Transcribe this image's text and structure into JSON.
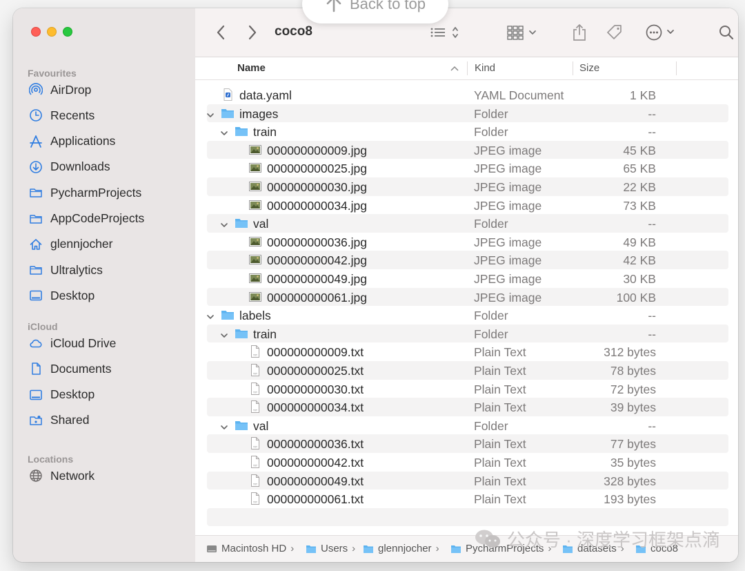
{
  "window": {
    "title": "coco8"
  },
  "back_to_top": "Back to top",
  "sidebar": {
    "sections": [
      {
        "title": "Favourites",
        "items": [
          {
            "label": "AirDrop",
            "icon": "airdrop-icon"
          },
          {
            "label": "Recents",
            "icon": "clock-icon"
          },
          {
            "label": "Applications",
            "icon": "applications-icon"
          },
          {
            "label": "Downloads",
            "icon": "download-icon"
          },
          {
            "label": "PycharmProjects",
            "icon": "folder-icon"
          },
          {
            "label": "AppCodeProjects",
            "icon": "folder-icon"
          },
          {
            "label": "glennjocher",
            "icon": "home-icon"
          },
          {
            "label": "Ultralytics",
            "icon": "folder-icon"
          },
          {
            "label": "Desktop",
            "icon": "desktop-icon"
          }
        ]
      },
      {
        "title": "iCloud",
        "items": [
          {
            "label": "iCloud Drive",
            "icon": "cloud-icon"
          },
          {
            "label": "Documents",
            "icon": "document-icon"
          },
          {
            "label": "Desktop",
            "icon": "desktop-icon"
          },
          {
            "label": "Shared",
            "icon": "shared-folder-icon"
          }
        ]
      },
      {
        "title": "Locations",
        "items": [
          {
            "label": "Network",
            "icon": "globe-icon"
          }
        ]
      }
    ]
  },
  "columns": {
    "name": "Name",
    "kind": "Kind",
    "size": "Size"
  },
  "files": [
    {
      "name": "data.yaml",
      "kind": "YAML Document",
      "size": "1 KB",
      "type": "yaml",
      "level": 0
    },
    {
      "name": "images",
      "kind": "Folder",
      "size": "--",
      "type": "folder",
      "level": 0,
      "expanded": true
    },
    {
      "name": "train",
      "kind": "Folder",
      "size": "--",
      "type": "folder",
      "level": 1,
      "expanded": true
    },
    {
      "name": "000000000009.jpg",
      "kind": "JPEG image",
      "size": "45 KB",
      "type": "jpg",
      "level": 2
    },
    {
      "name": "000000000025.jpg",
      "kind": "JPEG image",
      "size": "65 KB",
      "type": "jpg",
      "level": 2
    },
    {
      "name": "000000000030.jpg",
      "kind": "JPEG image",
      "size": "22 KB",
      "type": "jpg",
      "level": 2
    },
    {
      "name": "000000000034.jpg",
      "kind": "JPEG image",
      "size": "73 KB",
      "type": "jpg",
      "level": 2
    },
    {
      "name": "val",
      "kind": "Folder",
      "size": "--",
      "type": "folder",
      "level": 1,
      "expanded": true
    },
    {
      "name": "000000000036.jpg",
      "kind": "JPEG image",
      "size": "49 KB",
      "type": "jpg",
      "level": 2
    },
    {
      "name": "000000000042.jpg",
      "kind": "JPEG image",
      "size": "42 KB",
      "type": "jpg",
      "level": 2
    },
    {
      "name": "000000000049.jpg",
      "kind": "JPEG image",
      "size": "30 KB",
      "type": "jpg",
      "level": 2
    },
    {
      "name": "000000000061.jpg",
      "kind": "JPEG image",
      "size": "100 KB",
      "type": "jpg",
      "level": 2
    },
    {
      "name": "labels",
      "kind": "Folder",
      "size": "--",
      "type": "folder",
      "level": 0,
      "expanded": true
    },
    {
      "name": "train",
      "kind": "Folder",
      "size": "--",
      "type": "folder",
      "level": 1,
      "expanded": true
    },
    {
      "name": "000000000009.txt",
      "kind": "Plain Text",
      "size": "312 bytes",
      "type": "txt",
      "level": 2
    },
    {
      "name": "000000000025.txt",
      "kind": "Plain Text",
      "size": "78 bytes",
      "type": "txt",
      "level": 2
    },
    {
      "name": "000000000030.txt",
      "kind": "Plain Text",
      "size": "72 bytes",
      "type": "txt",
      "level": 2
    },
    {
      "name": "000000000034.txt",
      "kind": "Plain Text",
      "size": "39 bytes",
      "type": "txt",
      "level": 2
    },
    {
      "name": "val",
      "kind": "Folder",
      "size": "--",
      "type": "folder",
      "level": 1,
      "expanded": true
    },
    {
      "name": "000000000036.txt",
      "kind": "Plain Text",
      "size": "77 bytes",
      "type": "txt",
      "level": 2
    },
    {
      "name": "000000000042.txt",
      "kind": "Plain Text",
      "size": "35 bytes",
      "type": "txt",
      "level": 2
    },
    {
      "name": "000000000049.txt",
      "kind": "Plain Text",
      "size": "328 bytes",
      "type": "txt",
      "level": 2
    },
    {
      "name": "000000000061.txt",
      "kind": "Plain Text",
      "size": "193 bytes",
      "type": "txt",
      "level": 2
    }
  ],
  "pathbar": [
    "Macintosh HD",
    "Users",
    "glennjocher",
    "PycharmProjects",
    "datasets",
    "coco8"
  ],
  "watermark": "公众号 · 深度学习框架点滴",
  "colors": {
    "folder": "#5cb3f0",
    "accent": "#2f7de1"
  }
}
